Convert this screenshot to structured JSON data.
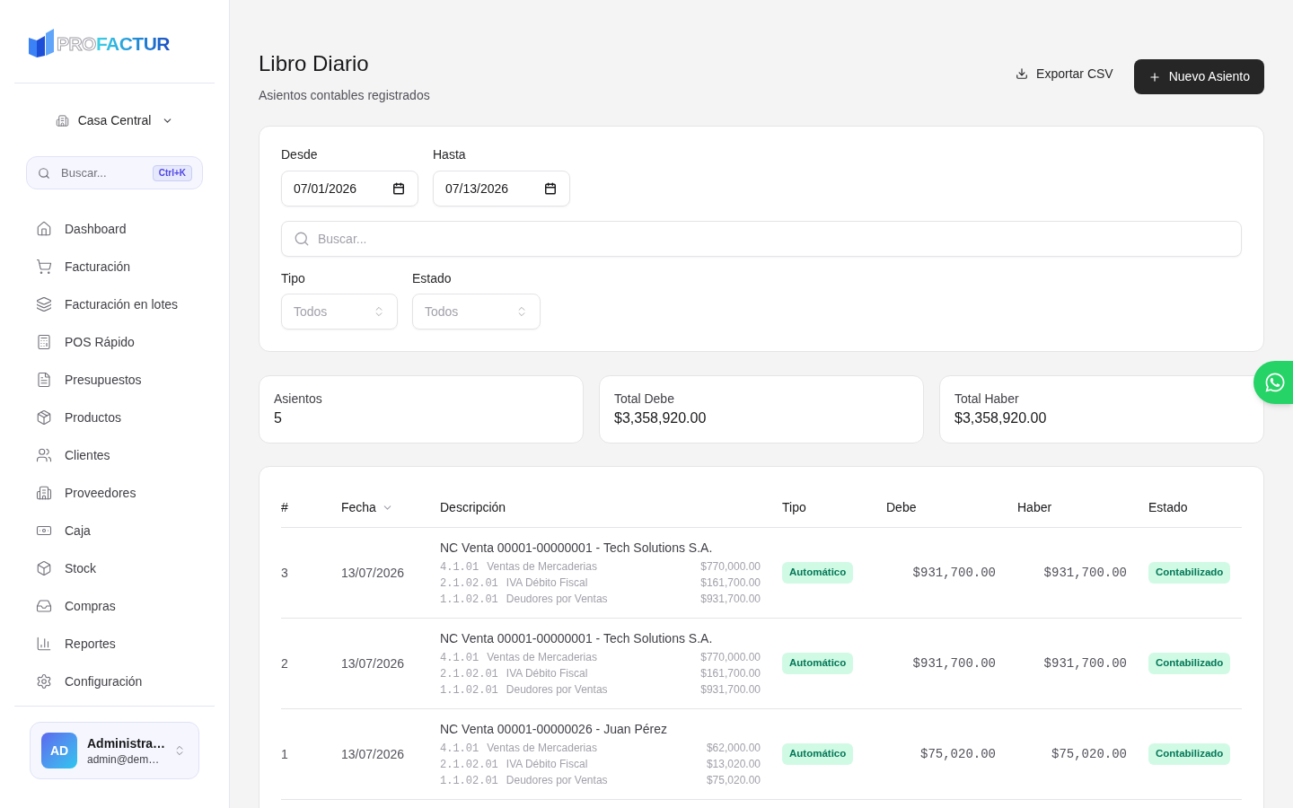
{
  "sidebar": {
    "brand": {
      "prefix": "PRO",
      "suffix": "FACTUR"
    },
    "branch": {
      "label": "Casa Central"
    },
    "search": {
      "placeholder": "Buscar...",
      "shortcut": "Ctrl+K"
    },
    "nav_items": [
      {
        "label": "Dashboard"
      },
      {
        "label": "Facturación"
      },
      {
        "label": "Facturación en lotes"
      },
      {
        "label": "POS Rápido"
      },
      {
        "label": "Presupuestos"
      },
      {
        "label": "Productos"
      },
      {
        "label": "Clientes"
      },
      {
        "label": "Proveedores"
      },
      {
        "label": "Caja"
      },
      {
        "label": "Stock"
      },
      {
        "label": "Compras"
      },
      {
        "label": "Reportes"
      },
      {
        "label": "Configuración"
      }
    ],
    "user": {
      "initials": "AD",
      "name": "Administra…",
      "email": "admin@dem…"
    }
  },
  "header": {
    "title": "Libro Diario",
    "subtitle": "Asientos contables registrados",
    "buttons": [
      {
        "label": "Exportar CSV",
        "kind": "ghost"
      },
      {
        "label": "Nuevo Asiento",
        "kind": "primary"
      }
    ]
  },
  "filters": {
    "dates": [
      {
        "label": "Desde",
        "value": "07/01/2026"
      },
      {
        "label": "Hasta",
        "value": "07/13/2026"
      }
    ],
    "search": {
      "placeholder": "Buscar..."
    },
    "selects": [
      {
        "label": "Tipo",
        "placeholder": "Todos"
      },
      {
        "label": "Estado",
        "placeholder": "Todos"
      }
    ]
  },
  "stats": [
    {
      "label": "Asientos",
      "value": "5"
    },
    {
      "label": "Total Debe",
      "value": "$3,358,920.00"
    },
    {
      "label": "Total Haber",
      "value": "$3,358,920.00"
    }
  ],
  "table": {
    "columns": [
      {
        "label": "#",
        "sorted": false
      },
      {
        "label": "Fecha",
        "sorted": true
      },
      {
        "label": "Descripción",
        "sorted": false
      },
      {
        "label": "Tipo",
        "sorted": false
      },
      {
        "label": "Debe",
        "sorted": false
      },
      {
        "label": "Haber",
        "sorted": false
      },
      {
        "label": "Estado",
        "sorted": false
      }
    ],
    "rows": [
      {
        "number": "3",
        "date": "13/07/2026",
        "description": "NC Venta 00001-00000001 - Tech Solutions S.A.",
        "lines": [
          {
            "code": "4.1.01",
            "account": "Ventas de Mercaderias",
            "amount": "$770,000.00"
          },
          {
            "code": "2.1.02.01",
            "account": "IVA Débito Fiscal",
            "amount": "$161,700.00"
          },
          {
            "code": "1.1.02.01",
            "account": "Deudores por Ventas",
            "amount": "$931,700.00"
          }
        ],
        "type": "Automático",
        "debit": "$931,700.00",
        "credit": "$931,700.00",
        "status": "Contabilizado"
      },
      {
        "number": "2",
        "date": "13/07/2026",
        "description": "NC Venta 00001-00000001 - Tech Solutions S.A.",
        "lines": [
          {
            "code": "4.1.01",
            "account": "Ventas de Mercaderias",
            "amount": "$770,000.00"
          },
          {
            "code": "2.1.02.01",
            "account": "IVA Débito Fiscal",
            "amount": "$161,700.00"
          },
          {
            "code": "1.1.02.01",
            "account": "Deudores por Ventas",
            "amount": "$931,700.00"
          }
        ],
        "type": "Automático",
        "debit": "$931,700.00",
        "credit": "$931,700.00",
        "status": "Contabilizado"
      },
      {
        "number": "1",
        "date": "13/07/2026",
        "description": "NC Venta 00001-00000026 - Juan Pérez",
        "lines": [
          {
            "code": "4.1.01",
            "account": "Ventas de Mercaderias",
            "amount": "$62,000.00"
          },
          {
            "code": "2.1.02.01",
            "account": "IVA Débito Fiscal",
            "amount": "$13,020.00"
          },
          {
            "code": "1.1.02.01",
            "account": "Deudores por Ventas",
            "amount": "$75,020.00"
          }
        ],
        "type": "Automático",
        "debit": "$75,020.00",
        "credit": "$75,020.00",
        "status": "Contabilizado"
      }
    ]
  }
}
